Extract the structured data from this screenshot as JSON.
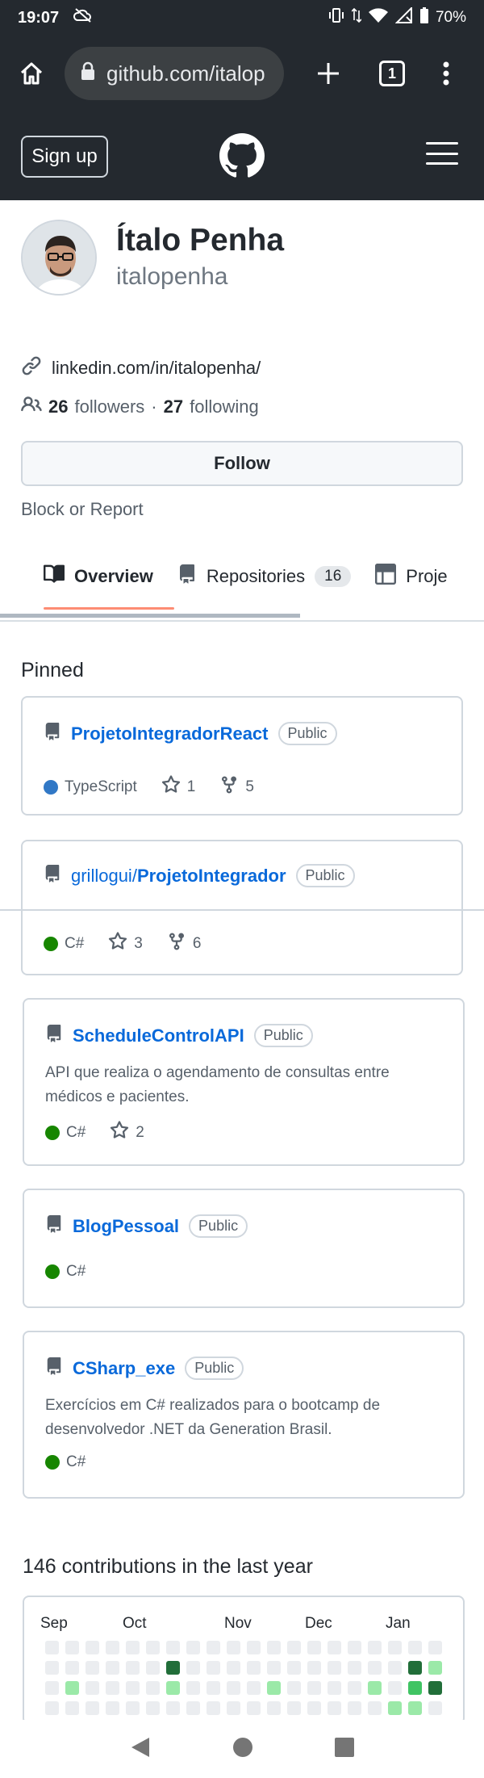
{
  "status_bar": {
    "time": "19:07",
    "battery": "70%"
  },
  "browser": {
    "url": "github.com/italop",
    "tab_count": "1"
  },
  "header": {
    "signup_label": "Sign up"
  },
  "profile": {
    "name": "Ítalo Penha",
    "login": "italopenha",
    "link": "linkedin.com/in/italopenha/",
    "followers_count": "26",
    "followers_label": "followers",
    "separator": "·",
    "following_count": "27",
    "following_label": "following",
    "follow_label": "Follow",
    "block_label": "Block or Report"
  },
  "tabs": [
    {
      "label": "Overview",
      "icon": "book-icon"
    },
    {
      "label": "Repositories",
      "count": "16",
      "icon": "repo-icon"
    },
    {
      "label": "Proje",
      "icon": "table-icon"
    }
  ],
  "pinned_title": "Pinned",
  "pinned": [
    {
      "owner": "",
      "name": "ProjetoIntegradorReact",
      "visibility": "Public",
      "language": "TypeScript",
      "lang_color": "#3178c6",
      "stars": "1",
      "forks": "5"
    },
    {
      "owner": "grillogui/",
      "name": "ProjetoIntegrador",
      "visibility": "Public",
      "language": "C#",
      "lang_color": "#178600",
      "stars": "3",
      "forks": "6"
    },
    {
      "owner": "",
      "name": "ScheduleControlAPI",
      "visibility": "Public",
      "description": "API que realiza o agendamento de consultas entre médicos e pacientes.",
      "language": "C#",
      "lang_color": "#178600",
      "stars": "2"
    },
    {
      "owner": "",
      "name": "BlogPessoal",
      "visibility": "Public",
      "language": "C#",
      "lang_color": "#178600"
    },
    {
      "owner": "",
      "name": "CSharp_exe",
      "visibility": "Public",
      "description": "Exercícios em C# realizados para o bootcamp de desenvolvedor .NET da Generation Brasil.",
      "language": "C#",
      "lang_color": "#178600"
    }
  ],
  "contributions": {
    "title": "146 contributions in the last year",
    "months": [
      "Sep",
      "Oct",
      "Nov",
      "Dec",
      "Jan"
    ],
    "colors": {
      "empty": "#ebedf0",
      "l1": "#9be9a8",
      "l2": "#40c463",
      "l3": "#216e39"
    }
  }
}
